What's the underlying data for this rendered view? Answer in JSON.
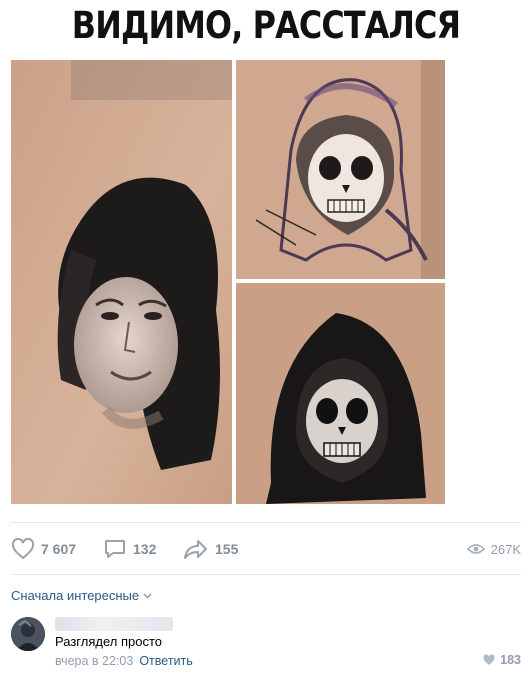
{
  "post": {
    "caption": "ВИДИМО, РАССТАЛСЯ",
    "photos": [
      {
        "icon": "girl-portrait-tattoo-image"
      },
      {
        "icon": "sketch-skull-tattoo-image"
      },
      {
        "icon": "grim-reaper-tattoo-image"
      }
    ]
  },
  "actions": {
    "likes": "7 607",
    "comments": "132",
    "shares": "155",
    "views": "267K"
  },
  "comments_section": {
    "sort_label": "Сначала интересные",
    "items": [
      {
        "text": "Разглядел просто",
        "time": "вчера в 22:03",
        "reply_label": "Ответить",
        "likes": "183"
      }
    ]
  },
  "colors": {
    "accent_link": "#2a5885",
    "muted": "#818c99",
    "divider": "#e7e8ec"
  }
}
